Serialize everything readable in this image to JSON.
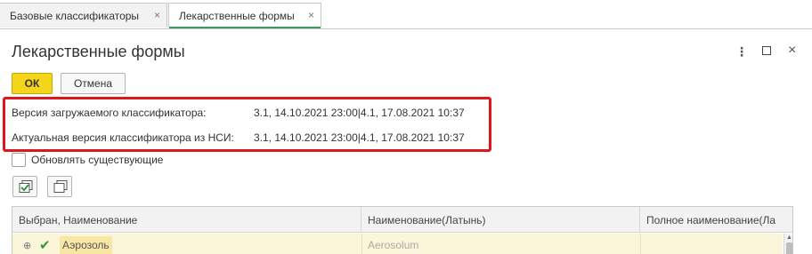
{
  "tabs": [
    {
      "label": "Базовые классификаторы",
      "close": "×"
    },
    {
      "label": "Лекарственные формы",
      "close": "×"
    }
  ],
  "form": {
    "title": "Лекарственные формы",
    "more_icon": "⋮",
    "close_icon": "×"
  },
  "buttons": {
    "ok": "ОК",
    "cancel": "Отмена"
  },
  "versions": {
    "loaded_label": "Версия загружаемого классификатора:",
    "loaded_value": "3.1, 14.10.2021 23:00|4.1, 17.08.2021 10:37",
    "actual_label": "Актуальная версия классификатора из НСИ:",
    "actual_value": "3.1, 14.10.2021 23:00|4.1, 17.08.2021 10:37"
  },
  "update_existing": {
    "label": "Обновлять существующие",
    "checked": false
  },
  "toolbar_icons": [
    "check-all-icon",
    "uncheck-all-icon"
  ],
  "table": {
    "columns": [
      "Выбран, Наименование",
      "Наименование(Латынь)",
      "Полное наименование(Ла"
    ],
    "rows": [
      {
        "expander": "⊕",
        "selected_mark": "✔",
        "name": "Аэрозоль",
        "latin": "Aerosolum",
        "full": ""
      }
    ]
  },
  "colors": {
    "accent_green": "#3c9a5f",
    "ok_button": "#f5d51b",
    "highlight_border": "#e0161f",
    "selected_row": "#fbf6d9"
  }
}
